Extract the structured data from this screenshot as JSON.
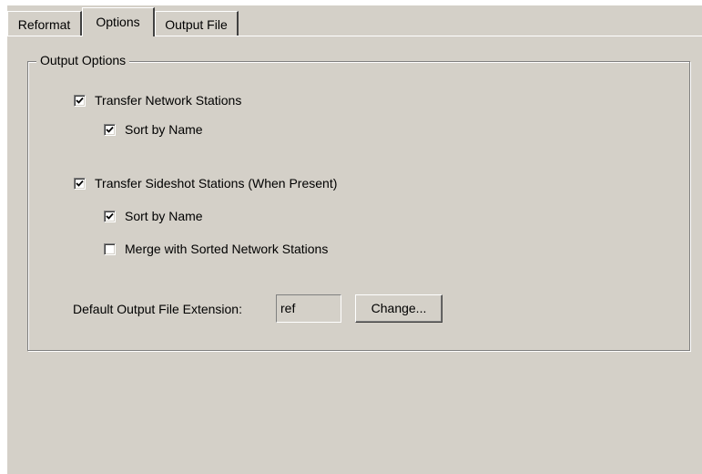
{
  "tabs": [
    {
      "label": "Reformat"
    },
    {
      "label": "Options",
      "selected": true
    },
    {
      "label": "Output File"
    }
  ],
  "group": {
    "title": "Output Options"
  },
  "options": {
    "transfer_network": {
      "label": "Transfer Network Stations",
      "checked": true
    },
    "sort_network": {
      "label": "Sort by Name",
      "checked": true
    },
    "transfer_sideshot": {
      "label": "Transfer Sideshot Stations (When Present)",
      "checked": true
    },
    "sort_sideshot": {
      "label": "Sort by Name",
      "checked": true
    },
    "merge_sorted": {
      "label": "Merge with Sorted Network Stations",
      "checked": false
    }
  },
  "extension": {
    "label": "Default Output File Extension:",
    "value": "ref",
    "change_label": "Change..."
  },
  "colors": {
    "face": "#d4d0c8",
    "shadow": "#808080",
    "highlight": "#ffffff"
  }
}
